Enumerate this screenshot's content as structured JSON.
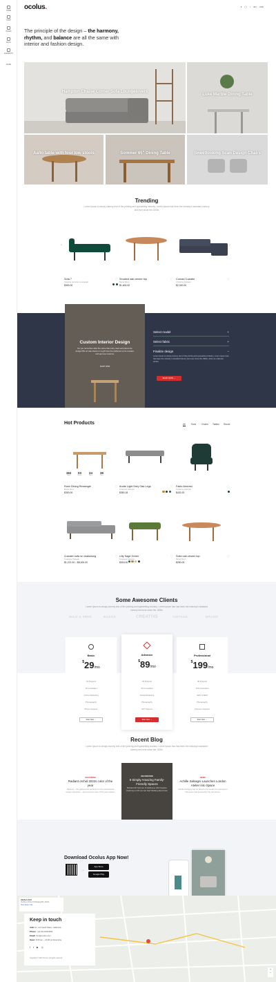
{
  "brand": {
    "name": "ocolus",
    "dot": ".",
    "accent": "#d32f2f"
  },
  "sidebar": {
    "items": [
      {
        "label": "HOME",
        "icon": "home-icon"
      },
      {
        "label": "SHOP",
        "icon": "shop-icon"
      },
      {
        "label": "PAGES",
        "icon": "pages-icon"
      },
      {
        "label": "BLOG",
        "icon": "blog-icon"
      },
      {
        "label": "ELEMENTS",
        "icon": "elements-icon"
      },
      {
        "label": "MORE",
        "icon": "more-icon"
      }
    ]
  },
  "header": {
    "lang": "EN",
    "currency": "USD"
  },
  "hero": {
    "text_pre": "The principle of the design – ",
    "harmony": "the harmony, rhythm,",
    "text_mid": " and ",
    "balance": "balance",
    "text_post": " are all the same with interior and fashion design."
  },
  "tiles": [
    {
      "label": "Hampton Chaise Corner Sofa Loungelovers"
    },
    {
      "label": "Luke Marble Dining Table"
    },
    {
      "label": "Aalto table with four low stools"
    },
    {
      "label": "Sommer 65\" Dining Table"
    },
    {
      "label": "Sweetlooking Scan Design Chairs"
    }
  ],
  "trending": {
    "title": "Trending",
    "subtitle": "Lorem Ipsum is simply dummy text of the printing and typesetting industry. Lorem Ipsum has been the industry's standard dummy text ever since the 1500s",
    "products": [
      {
        "name": "Sofa 7",
        "sub": "Cassina Lamotte Loungegal",
        "price": "$300.00"
      },
      {
        "name": "Smoked oak veneer top",
        "sub": "Bezel Shen",
        "price": "$1,600.00"
      },
      {
        "name": "Conrad 3-seater",
        "sub": "Christine Quirajet",
        "price": "$2,020.00"
      }
    ]
  },
  "custom": {
    "title": "Custom Interior Design",
    "text": "Do you remember after the stone that many stars and plants the design fifth ed was shown on a gift from the craftsman to be created, and get new customs.",
    "btn_small": "SHOP NOW",
    "accordion": [
      {
        "label": "Select model"
      },
      {
        "label": "Select fabric"
      },
      {
        "label": "Finalize design"
      }
    ],
    "accordion_text": "Lorem Ipsum is simply dummy text of the printing and typesetting industry. Lorem Ipsum has has been the industry's standard dummy text ever since the 1500s, when an unknown printer.",
    "cta": "SHOP NOW →"
  },
  "hot": {
    "title": "Hot Products",
    "tabs": [
      "All",
      "Sofa",
      "Chairs",
      "Tables",
      "Stools"
    ],
    "countdown": [
      {
        "value": "192",
        "unit": "Days"
      },
      {
        "value": "03",
        "unit": "Hours"
      },
      {
        "value": "24",
        "unit": "Mins"
      },
      {
        "value": "36",
        "unit": "Secs"
      }
    ],
    "products": [
      {
        "name": "Rorix Dining Rectangle",
        "sub": "Bezel Shen",
        "price": "$300.00"
      },
      {
        "name": "Andie Light Grey Oak Legs",
        "sub": "Costume Kaisuko",
        "price": "$350.18"
      },
      {
        "name": "Fabio Armrest",
        "sub": "Costume Kaisuko",
        "price": "$420.20"
      },
      {
        "name": "3-seater sofa w/ chaiselong",
        "sub": "Costume Kaisuko",
        "price": "$1,221.00 – $8,000.00"
      },
      {
        "name": "Lilly Sage Green",
        "sub": "Costume Kaisuko",
        "price": "$315.00"
      },
      {
        "name": "Solid oak veneer top",
        "sub": "Bezel Shen",
        "price": "$250.00"
      }
    ]
  },
  "clients": {
    "title": "Some Awesome Clients",
    "subtitle": "Lorem Ipsum is simply dummy text of the printing and typesetting industry. Lorem Ipsum has has been the industry's standard dummy text ever since the 1500s",
    "logos": [
      "WILD & FREE",
      "BADGE",
      "CREATIVE",
      "VINTAGE",
      "BRAND"
    ]
  },
  "pricing": [
    {
      "name": "Basic",
      "currency": "$",
      "amount": "29",
      "period": "/mo",
      "features": [
        "10 Projects",
        "15 Consultant",
        "Online Marketing",
        "Photography",
        "Phone Support"
      ],
      "cta": "Start Now →"
    },
    {
      "name": "Advance",
      "currency": "$",
      "amount": "89",
      "period": "/mo",
      "features": [
        "25 Projects",
        "40 Consultant",
        "Social Marketing",
        "Photography",
        "24/7 Support"
      ],
      "cta": "Start Now →"
    },
    {
      "name": "Professional",
      "currency": "$",
      "amount": "199",
      "period": "/mo",
      "features": [
        "90 Projects",
        "120 Consultant",
        "SEO & SEM",
        "Photography",
        "Premium Support"
      ],
      "cta": "Start Now →"
    }
  ],
  "blog": {
    "title": "Recent Blog",
    "subtitle": "Lorem Ipsum is simply dummy text of the printing and typesetting industry. Lorem Ipsum has has been the industry's standard dummy text ever since the 1500s",
    "posts": [
      {
        "cat": "COLOURING",
        "title": "Radiant orchid 2022s color of the year",
        "excerpt": "Pantone – the global color authority for the professional design industries – announced a color of the year indeed."
      },
      {
        "cat": "DECORATION",
        "title": "6 Simply Amazing Family-Friendly Spaces",
        "excerpt": "Richard Mc Norman & Radhouse 22th Feature Yearlong on DC we can start thinking about how."
      },
      {
        "cat": "NEWS",
        "title": "Achille Salvagni Launches London Atelier into Space",
        "excerpt": "Achille Salvagni has he laced in the studio it's premises in the space that inspired by the old shores."
      }
    ]
  },
  "app": {
    "title": "Download Ocolus App Now!",
    "app_store": "App Store",
    "google_play": "Google Play"
  },
  "contact": {
    "title": "Keep in touch",
    "lines": [
      {
        "k": "Add:",
        "v": "No. 1/2 South Place, California"
      },
      {
        "k": "Phone:",
        "v": "+(2)-00-2248-6811"
      },
      {
        "k": "Email:",
        "v": "info@ocolus.com"
      },
      {
        "k": "Open:",
        "v": "8:00 am – 21:00 pm Everyday"
      }
    ],
    "copyright": "Copyright © 2022 Ocolus. All rights reserved."
  },
  "map": {
    "place": "Ola Beco 93 E",
    "address": "Via Beco 93 Ea 10 Bologna BO, 40121",
    "link": "View larger map"
  }
}
